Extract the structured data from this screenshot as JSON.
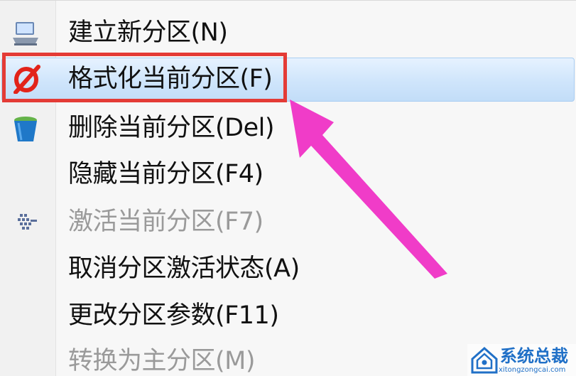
{
  "menu": {
    "items": [
      {
        "label": "建立新分区(N)",
        "icon": "new-partition-icon",
        "enabled": true
      },
      {
        "label": "格式化当前分区(F)",
        "icon": "format-icon",
        "enabled": true,
        "highlighted": true
      },
      {
        "label": "删除当前分区(Del)",
        "icon": "recycle-bin-icon",
        "enabled": true
      },
      {
        "label": "隐藏当前分区(F4)",
        "icon": "",
        "enabled": true
      },
      {
        "label": "激活当前分区(F7)",
        "icon": "activate-icon",
        "enabled": false
      },
      {
        "label": "取消分区激活状态(A)",
        "icon": "",
        "enabled": true
      },
      {
        "label": "更改分区参数(F11)",
        "icon": "",
        "enabled": true
      },
      {
        "label": "转换为主分区(M)",
        "icon": "",
        "enabled": false
      }
    ]
  },
  "annotation": {
    "box_color": "#e43b36",
    "arrow_color": "#f03cc8"
  },
  "watermark": {
    "title": "系统总裁",
    "subtitle": "xitongzongcai.com"
  },
  "colors": {
    "highlight": "#cfe5fb",
    "text": "#111111",
    "disabled_text": "#9a9a9a"
  }
}
